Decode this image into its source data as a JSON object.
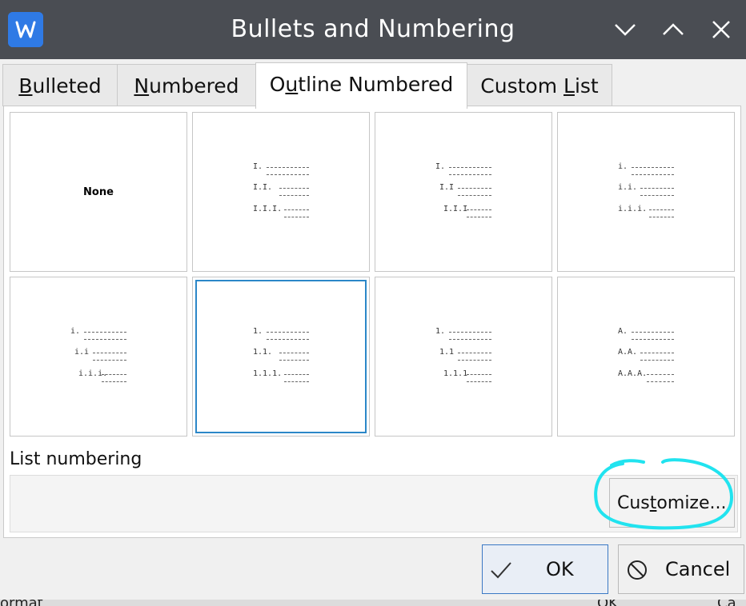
{
  "window": {
    "title": "Bullets and Numbering",
    "app_icon": "wps-writer-icon"
  },
  "tabs": [
    {
      "label_pre": "",
      "label_ul": "B",
      "label_post": "ulleted",
      "active": false
    },
    {
      "label_pre": "",
      "label_ul": "N",
      "label_post": "umbered",
      "active": false
    },
    {
      "label_pre": "O",
      "label_ul": "u",
      "label_post": "tline Numbered",
      "active": true
    },
    {
      "label_pre": "Custom ",
      "label_ul": "L",
      "label_post": "ist",
      "active": false
    }
  ],
  "presets": [
    {
      "none_label": "None"
    },
    {
      "levels": [
        "I.",
        "I.I.",
        "I.I.I."
      ]
    },
    {
      "levels": [
        "I.",
        "I.I",
        "I.I.I"
      ]
    },
    {
      "levels": [
        "i.",
        "i.i.",
        "i.i.i."
      ]
    },
    {
      "levels": [
        "i.",
        "i.i",
        "i.i.i."
      ]
    },
    {
      "levels": [
        "1.",
        "1.1.",
        "1.1.1."
      ],
      "selected": true
    },
    {
      "levels": [
        "1.",
        "1.1",
        "1.1.1"
      ]
    },
    {
      "levels": [
        "A.",
        "A.A.",
        "A.A.A."
      ]
    }
  ],
  "list_numbering": {
    "label": "List numbering",
    "customize_pre": "Cus",
    "customize_ul": "t",
    "customize_post": "omize..."
  },
  "buttons": {
    "ok": "OK",
    "cancel": "Cancel"
  },
  "footer": {
    "left_text": "ormat",
    "ok_text": "OK",
    "cancel_text": "Ca"
  },
  "colors": {
    "titlebar": "#4a4d53",
    "selection": "#2b87c8",
    "annotation": "#21e3ef",
    "ok_border": "#3a78c4"
  }
}
